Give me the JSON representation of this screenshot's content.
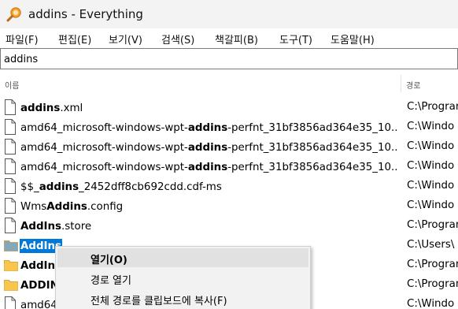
{
  "window": {
    "title": "addins - Everything"
  },
  "menu": [
    "파일(F)",
    "편집(E)",
    "보기(V)",
    "검색(S)",
    "책갈피(B)",
    "도구(T)",
    "도움말(H)"
  ],
  "search": {
    "value": "addins"
  },
  "columns": {
    "name": "이름",
    "path": "경로"
  },
  "rows": [
    {
      "icon": "document-icon",
      "pre": "",
      "bold": "addins",
      "post": ".xml",
      "path": "C:\\Program"
    },
    {
      "icon": "document-icon",
      "pre": "amd64_microsoft-windows-wpt-",
      "bold": "addins",
      "post": "-perfnt_31bf3856ad364e35_10....",
      "path": "C:\\Windo"
    },
    {
      "icon": "document-icon",
      "pre": "amd64_microsoft-windows-wpt-",
      "bold": "addins",
      "post": "-perfnt_31bf3856ad364e35_10....",
      "path": "C:\\Windo"
    },
    {
      "icon": "document-icon",
      "pre": "amd64_microsoft-windows-wpt-",
      "bold": "addins",
      "post": "-perfnt_31bf3856ad364e35_10....",
      "path": "C:\\Windo"
    },
    {
      "icon": "document-icon",
      "pre": "$$_",
      "bold": "addins",
      "post": "_2452dff8cb692cdd.cdf-ms",
      "path": "C:\\Windo"
    },
    {
      "icon": "document-icon",
      "pre": "Wms",
      "bold": "Addins",
      "post": ".config",
      "path": "C:\\Windo"
    },
    {
      "icon": "document-icon",
      "pre": "",
      "bold": "AddIns",
      "post": ".store",
      "path": "C:\\Program"
    },
    {
      "icon": "folder-icon",
      "pre": "",
      "bold": "AddIns",
      "post": "",
      "path": "C:\\Users\\",
      "selected": true
    },
    {
      "icon": "folder-icon",
      "pre": "",
      "bold": "AddIns",
      "post": "",
      "path": "C:\\Program"
    },
    {
      "icon": "folder-icon",
      "pre": "",
      "bold": "ADDINS",
      "post": "",
      "path": "C:\\Program"
    },
    {
      "icon": "document-icon",
      "pre": "amd64",
      "bold": "",
      "post": "",
      "path": "C:\\Windo"
    }
  ],
  "context_menu": [
    {
      "label": "열기(O)",
      "bold": true,
      "hover": true
    },
    {
      "label": "경로 열기",
      "bold": false,
      "hover": false
    },
    {
      "label": "전체 경로를 클립보드에 복사(F)",
      "bold": false,
      "hover": false
    }
  ],
  "colors": {
    "selection": "#0078d7",
    "folder": "#f8c64a"
  }
}
